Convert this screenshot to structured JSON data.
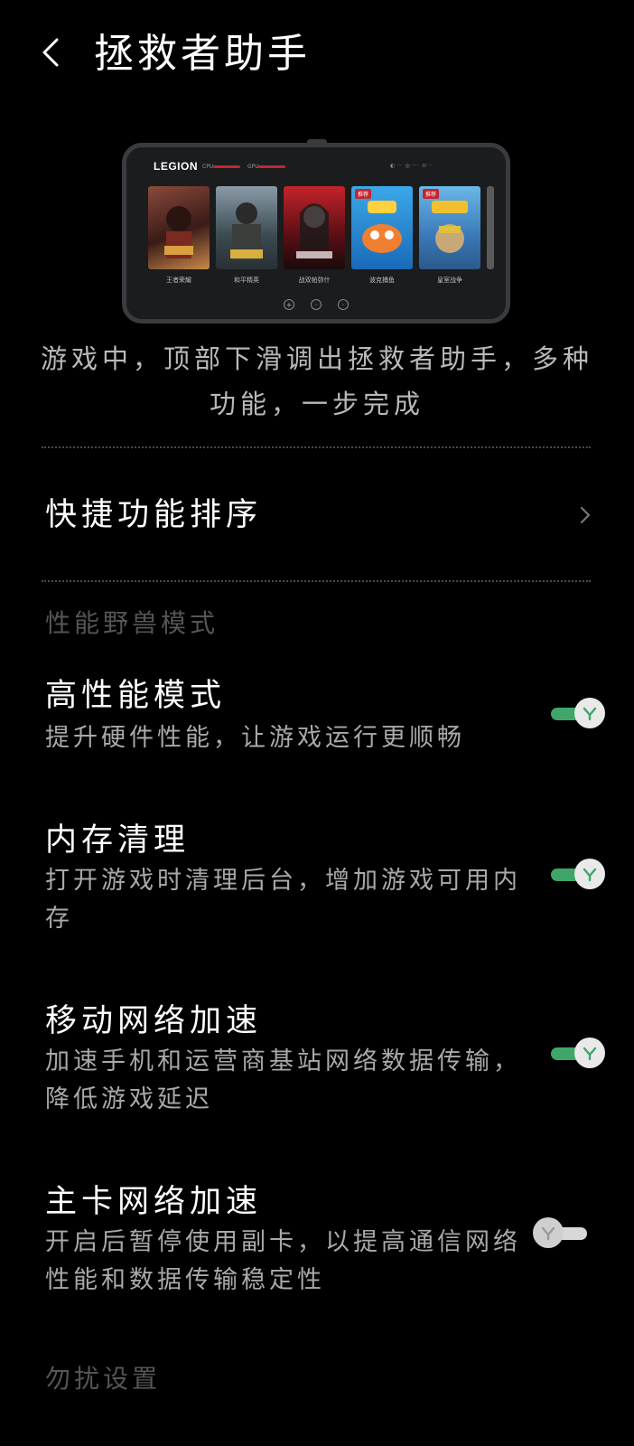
{
  "header": {
    "title": "拯救者助手"
  },
  "illustration": {
    "brand": "LEGION",
    "cpu_label": "CPU",
    "gpu_label": "GPU",
    "games": [
      {
        "label": "王者荣耀",
        "badge": ""
      },
      {
        "label": "和平精英",
        "badge": ""
      },
      {
        "label": "战双帕弥什",
        "badge": ""
      },
      {
        "label": "波克捕鱼",
        "badge": "推荐"
      },
      {
        "label": "皇室战争",
        "badge": "推荐"
      }
    ]
  },
  "intro_text": "游戏中，顶部下滑调出拯救者助手，多种功能，一步完成",
  "quick_sort": {
    "label": "快捷功能排序"
  },
  "section_performance": {
    "header": "性能野兽模式",
    "items": [
      {
        "title": "高性能模式",
        "subtitle": "提升硬件性能，让游戏运行更顺畅",
        "enabled": true
      },
      {
        "title": "内存清理",
        "subtitle": "打开游戏时清理后台，增加游戏可用内存",
        "enabled": true
      },
      {
        "title": "移动网络加速",
        "subtitle": "加速手机和运营商基站网络数据传输，降低游戏延迟",
        "enabled": true
      },
      {
        "title": "主卡网络加速",
        "subtitle": "开启后暂停使用副卡，以提高通信网络性能和数据传输稳定性",
        "enabled": false
      }
    ]
  },
  "section_dnd": {
    "header": "勿扰设置"
  },
  "colors": {
    "toggle_on": "#3fa66a",
    "toggle_off": "#d8d8d8",
    "background": "#000000"
  }
}
